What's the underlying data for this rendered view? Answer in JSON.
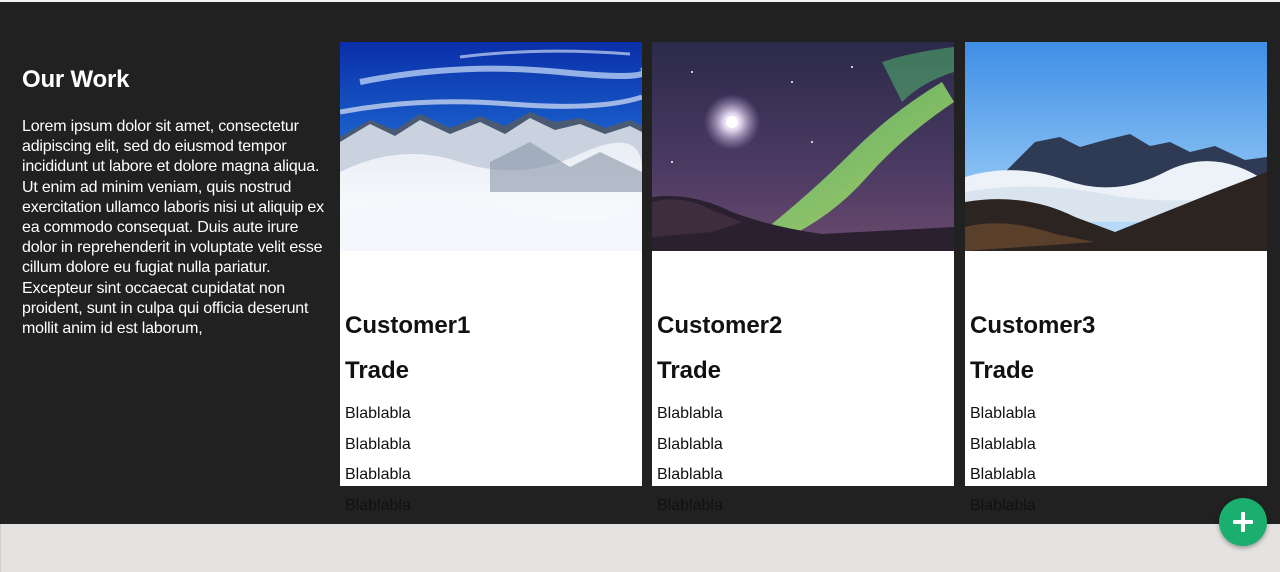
{
  "section": {
    "title": "Our Work",
    "description": "Lorem ipsum dolor sit amet, consectetur adipiscing elit, sed do eiusmod tempor incididunt ut labore et dolore magna aliqua. Ut enim ad minim veniam, quis nostrud exercitation ullamco laboris nisi ut aliquip ex ea commodo consequat. Duis aute irure dolor in reprehenderit in voluptate velit esse cillum dolore eu fugiat nulla pariatur. Excepteur sint occaecat cupidatat non proident, sunt in culpa qui officia deserunt mollit anim id est laborum,"
  },
  "cards": [
    {
      "image": "snowy-mountains",
      "customer": "Customer1",
      "trade": "Trade",
      "lines": [
        "Blablabla",
        "Blablabla",
        "Blablabla",
        "Blablabla"
      ]
    },
    {
      "image": "northern-lights",
      "customer": "Customer2",
      "trade": "Trade",
      "lines": [
        "Blablabla",
        "Blablabla",
        "Blablabla",
        "Blablabla"
      ]
    },
    {
      "image": "mountains-above-clouds",
      "customer": "Customer3",
      "trade": "Trade",
      "lines": [
        "Blablabla",
        "Blablabla",
        "Blablabla",
        "Blablabla"
      ]
    }
  ],
  "fab": {
    "icon": "plus-icon",
    "color": "#1aae6f"
  },
  "colors": {
    "section_bg": "#212121",
    "page_bg": "#e4e3e1",
    "card_bg": "#ffffff"
  }
}
